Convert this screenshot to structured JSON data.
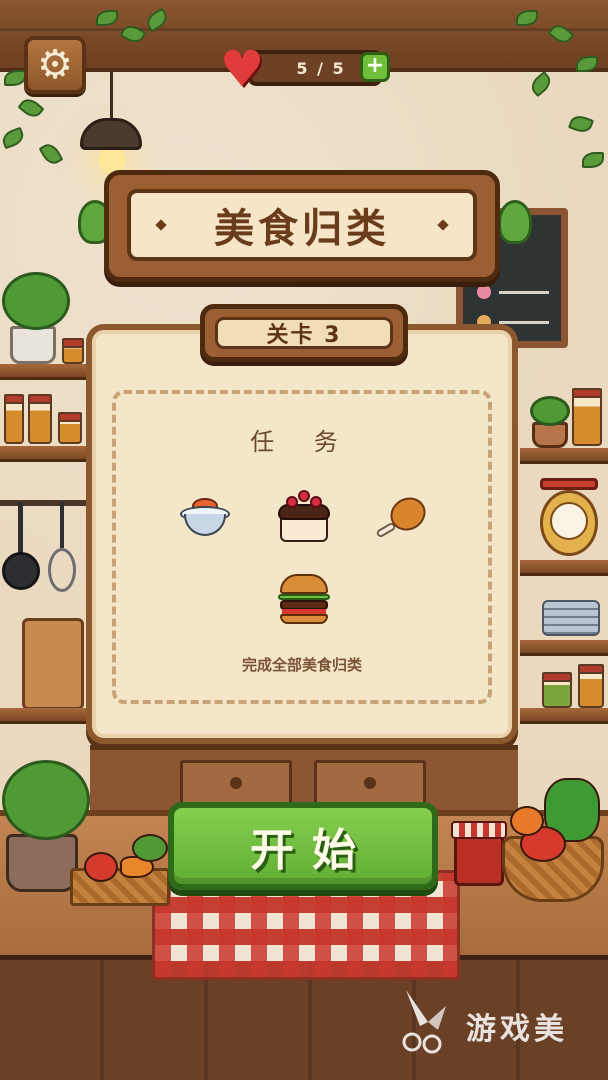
{
  "hud": {
    "lives": "5 / 5",
    "settings_icon": "gear-icon",
    "heart_icon": "heart-icon",
    "plus_icon": "plus-icon"
  },
  "title": "美食归类",
  "level": {
    "label": "关卡 3",
    "task_title": "任 务",
    "items": [
      "sushi-bowl-icon",
      "chocolate-cake-icon",
      "chicken-leg-icon",
      "burger-icon"
    ],
    "hint": "完成全部美食归类"
  },
  "start_label": "开始",
  "watermark": {
    "text": "游戏美"
  },
  "colors": {
    "start_green": "#6fbf3b",
    "wood_brown": "#9b5f33",
    "panel_cream": "#f4e6c9",
    "heart_red": "#e03b3b"
  }
}
